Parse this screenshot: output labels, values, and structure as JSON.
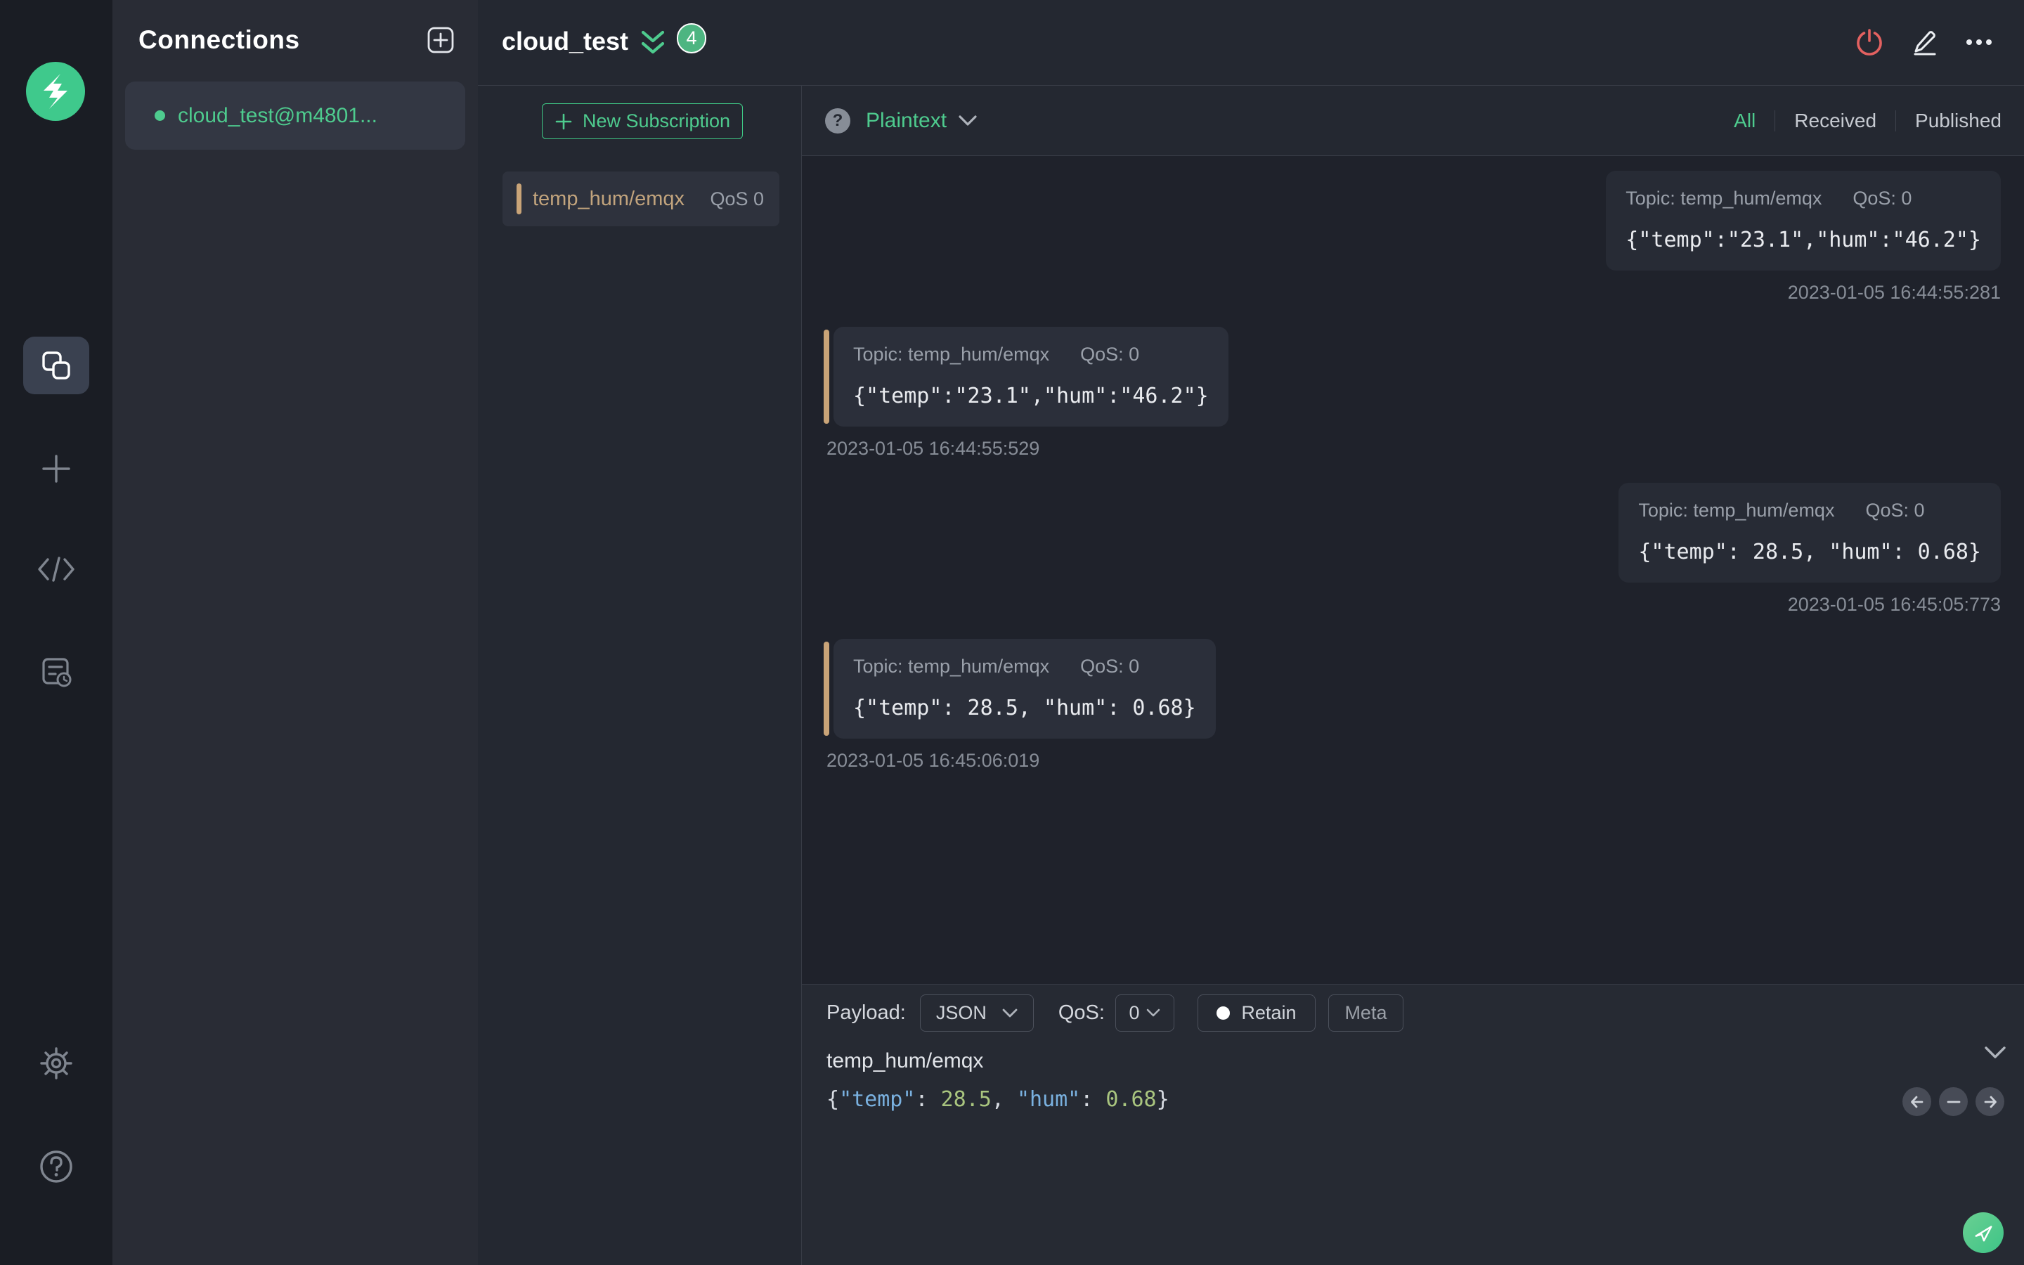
{
  "colors": {
    "accent": "#34c388",
    "green_text": "#4ecb8e",
    "topic_tan": "#c2a47d",
    "danger": "#e36160",
    "badge": "#4db581"
  },
  "sidebar": {
    "icons": [
      "mqttx-logo",
      "connections",
      "new-connection",
      "script",
      "log",
      "settings",
      "help"
    ]
  },
  "connections_panel": {
    "title": "Connections",
    "items": [
      {
        "label": "cloud_test@m4801...",
        "status": "connected"
      }
    ]
  },
  "header": {
    "title": "cloud_test",
    "message_count": "4"
  },
  "subscriptions_panel": {
    "new_subscription_label": "New Subscription",
    "items": [
      {
        "topic": "temp_hum/emqx",
        "qos": "QoS 0"
      }
    ]
  },
  "messages_panel": {
    "payload_format": "Plaintext",
    "filters": [
      {
        "label": "All",
        "active": true
      },
      {
        "label": "Received",
        "active": false
      },
      {
        "label": "Published",
        "active": false
      }
    ],
    "messages": [
      {
        "direction": "published",
        "topic": "Topic: temp_hum/emqx",
        "qos": "QoS: 0",
        "payload": "{\"temp\":\"23.1\",\"hum\":\"46.2\"}",
        "time": "2023-01-05 16:44:55:281"
      },
      {
        "direction": "received",
        "topic": "Topic: temp_hum/emqx",
        "qos": "QoS: 0",
        "payload": "{\"temp\":\"23.1\",\"hum\":\"46.2\"}",
        "time": "2023-01-05 16:44:55:529"
      },
      {
        "direction": "published",
        "topic": "Topic: temp_hum/emqx",
        "qos": "QoS: 0",
        "payload": "{\"temp\": 28.5, \"hum\": 0.68}",
        "time": "2023-01-05 16:45:05:773"
      },
      {
        "direction": "received",
        "topic": "Topic: temp_hum/emqx",
        "qos": "QoS: 0",
        "payload": "{\"temp\": 28.5, \"hum\": 0.68}",
        "time": "2023-01-05 16:45:06:019"
      }
    ]
  },
  "publish_panel": {
    "payload_label": "Payload:",
    "payload_format": "JSON",
    "qos_label": "QoS:",
    "qos_value": "0",
    "retain_label": "Retain",
    "meta_label": "Meta",
    "topic": "temp_hum/emqx",
    "payload_tokens": [
      {
        "text": "{",
        "type": "punct"
      },
      {
        "text": "\"temp\"",
        "type": "key"
      },
      {
        "text": ": ",
        "type": "punct"
      },
      {
        "text": "28.5",
        "type": "number"
      },
      {
        "text": ", ",
        "type": "punct"
      },
      {
        "text": "\"hum\"",
        "type": "key"
      },
      {
        "text": ": ",
        "type": "punct"
      },
      {
        "text": "0.68",
        "type": "number"
      },
      {
        "text": "}",
        "type": "punct"
      }
    ]
  }
}
